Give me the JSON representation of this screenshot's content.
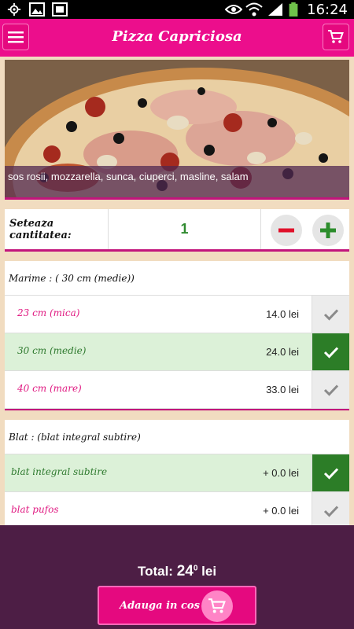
{
  "status_bar": {
    "time": "16:24"
  },
  "header": {
    "title": "Pizza Capriciosa",
    "menu_icon": "menu-icon",
    "cart_icon": "cart-icon"
  },
  "product": {
    "ingredients": "sos rosii, mozzarella, sunca, ciuperci, masline, salam"
  },
  "quantity": {
    "label": "Seteaza cantitatea:",
    "value": "1",
    "minus_icon": "minus-icon",
    "plus_icon": "plus-icon"
  },
  "size": {
    "title": "Marime : (  30 cm (medie))",
    "options": [
      {
        "name": "23 cm (mica)",
        "price": "14.0 lei",
        "selected": false
      },
      {
        "name": "30 cm (medie)",
        "price": "24.0 lei",
        "selected": true
      },
      {
        "name": "40 cm (mare)",
        "price": "33.0 lei",
        "selected": false
      }
    ]
  },
  "crust": {
    "title": "Blat : (blat integral subtire)",
    "options": [
      {
        "name": "blat integral subtire",
        "price": "+ 0.0 lei",
        "selected": true
      },
      {
        "name": "blat pufos",
        "price": "+ 0.0 lei",
        "selected": false
      }
    ]
  },
  "footer": {
    "total_label": "Total:",
    "total_value": "24",
    "total_decimal": "0",
    "currency": "lei",
    "add_button_label": "Adauga in cos"
  },
  "colors": {
    "brand": "#ec0e8c",
    "footer": "#4d1e45",
    "selected": "#2c7d27",
    "selected_bg": "#dcf1d8"
  }
}
